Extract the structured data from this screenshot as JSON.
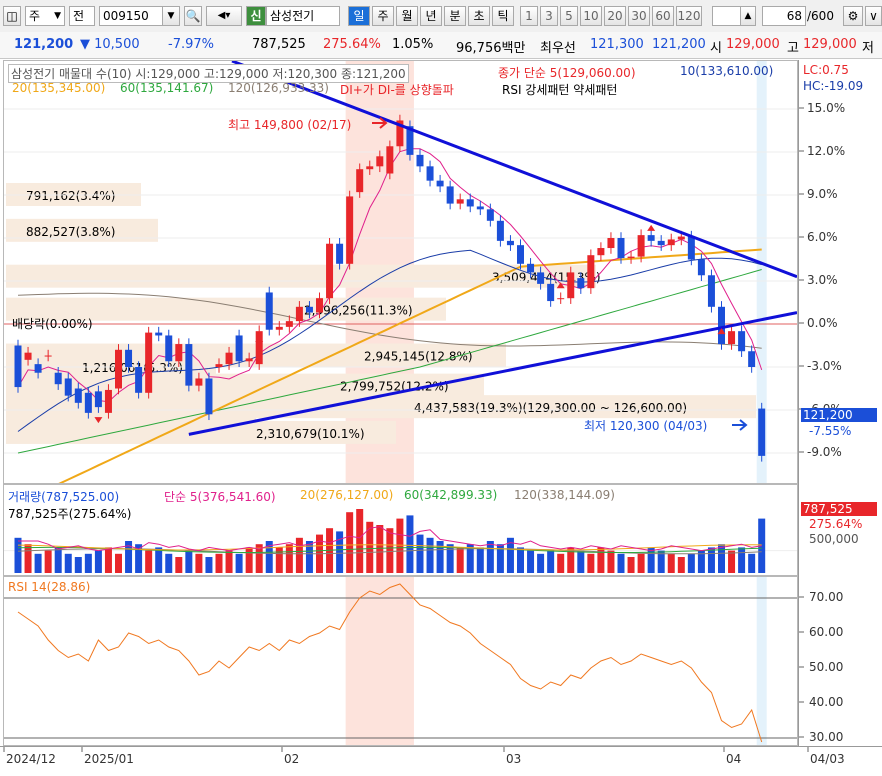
{
  "toolbar": {
    "type_select": "주",
    "mode_select": "전",
    "stock_code": "009150",
    "badge_new": "신",
    "stock_name": "삼성전기",
    "periods": [
      "일",
      "주",
      "월",
      "년",
      "분",
      "초",
      "틱"
    ],
    "active_period": "일",
    "numbers": [
      "1",
      "3",
      "5",
      "10",
      "20",
      "30",
      "60",
      "120"
    ],
    "page_count": "68",
    "page_total": "/600"
  },
  "info": {
    "price": "121,200",
    "change": "▼ 10,500",
    "change_rate": "-7.97%",
    "volume": "787,525",
    "volume_rate": "275.64%",
    "turnover": "1.05%",
    "amount": "96,756백만",
    "best_label": "최우선",
    "ask": "121,300",
    "bid": "121,200",
    "open_label": "시",
    "open": "129,000",
    "high_label": "고",
    "high": "129,000",
    "low_label": "저"
  },
  "price_panel": {
    "header": "삼성전기 매물대 수(10)  시:129,000 고:129,000 저:120,300 종:121,200",
    "ma5_label": "종가 단순 5(129,060.00)",
    "ma10_label": "10(133,610.00)",
    "ma20_label": "20(135,345.00)",
    "ma60_label": "60(135,141.67)",
    "ma120_label": "120(126,933.33)",
    "di_label": "DI+가 DI-를 상향돌파",
    "rsi_pattern_label": "RSI 강세패턴  약세패턴",
    "lc": "LC:0.75",
    "hc": "HC:-19.09",
    "dividend_label": "배당락(0.00%)",
    "high_annot": "최고 149,800 (02/17)",
    "low_annot": "최저 120,300 (04/03)",
    "current_price_tag": "121,200",
    "current_pct_tag": "-7.55%",
    "volume_profile": [
      {
        "label": "791,162(3.4%)"
      },
      {
        "label": "882,527(3.8%)"
      },
      {
        "label": "3,509,424(15.3%)"
      },
      {
        "label": "2,596,256(11.3%)"
      },
      {
        "label": "2,945,145(12.8%)"
      },
      {
        "label": "1,216,061(5.3%)"
      },
      {
        "label": "2,799,752(12.2%)"
      },
      {
        "label": "4,437,583(19.3%)(129,300.00 ~ 126,600.00)"
      },
      {
        "label": "1,491,380(6.5%)"
      },
      {
        "label": "2,310,679(10.1%)"
      }
    ],
    "y_ticks": [
      "15.0%",
      "12.0%",
      "9.0%",
      "6.0%",
      "3.0%",
      "0.0%",
      "-3.0%",
      "-6.0%",
      "-9.0%"
    ]
  },
  "volume_panel": {
    "header": "거래량(787,525.00)",
    "ma5": "단순 5(376,541.60)",
    "ma20": "20(276,127.00)",
    "ma60": "60(342,899.33)",
    "ma120": "120(338,144.09)",
    "sub": "787,525주(275.64%)",
    "tag_volume": "787,525",
    "tag_pct": "275.64%",
    "y_tick": "500,000"
  },
  "rsi_panel": {
    "header": "RSI 14(28.86)",
    "y_ticks": [
      "70.00",
      "60.00",
      "50.00",
      "40.00",
      "30.00"
    ]
  },
  "x_axis": [
    "2024/12",
    "2025/01",
    "02",
    "03",
    "04",
    "04/03"
  ],
  "colors": {
    "up": "#e8262a",
    "down": "#1b4fd8",
    "ma5": "#e0208c",
    "ma10": "#1a3da8",
    "ma20": "#f0a818",
    "ma60": "#2ea83e",
    "ma120": "#8a7e72",
    "trend": "#1010d8",
    "rsi": "#f07820"
  },
  "chart_data": [
    {
      "type": "candlestick",
      "title": "삼성전기",
      "y_unit": "% change",
      "ylim": [
        -9,
        15
      ],
      "x_range": [
        "2024/12",
        "2025/04/03"
      ],
      "x": [
        "2024/12",
        "",
        "",
        "",
        "",
        "",
        "",
        "2025/01",
        "",
        "",
        "",
        "",
        "",
        "",
        "",
        "",
        "",
        "",
        "",
        "",
        "",
        "",
        "",
        "",
        "",
        "",
        "02",
        "",
        "",
        "",
        "",
        "",
        "",
        "",
        "",
        "",
        "",
        "",
        "",
        "",
        "",
        "",
        "",
        "",
        "",
        "",
        "03",
        "",
        "",
        "",
        "",
        "",
        "",
        "",
        "",
        "",
        "",
        "",
        "",
        "",
        "",
        "",
        "",
        "",
        "",
        "",
        "",
        "",
        "04",
        "",
        "",
        "04/03"
      ],
      "series": [
        {
          "name": "price",
          "open": [
            -1.5,
            -2.5,
            -2.8,
            -2.2,
            -3.4,
            -3.8,
            -4.5,
            -4.8,
            -4.7,
            -6.2,
            -4.5,
            -1.8,
            -3.0,
            -4.8,
            -0.6,
            -0.8,
            -2.6,
            -1.4,
            -4.3,
            -3.8,
            -3.0,
            -2.8,
            -0.8,
            -2.6,
            -2.8,
            2.2,
            -0.4,
            -0.2,
            0.2,
            1.2,
            0.8,
            1.8,
            5.6,
            4.2,
            9.2,
            10.8,
            11.0,
            10.5,
            12.4,
            13.8,
            11.8,
            11.0,
            10.0,
            9.6,
            8.4,
            8.7,
            8.2,
            8.0,
            7.2,
            5.8,
            5.5,
            4.2,
            3.6,
            2.8,
            1.8,
            1.8,
            3.2,
            2.5,
            4.8,
            5.3,
            6.0,
            4.6,
            4.7,
            6.2,
            5.8,
            5.5,
            5.9,
            6.1,
            4.5,
            3.4,
            1.2,
            -1.4,
            -0.5,
            -1.9,
            -5.9
          ],
          "close": [
            -4.4,
            -2.0,
            -3.4,
            -2.2,
            -4.2,
            -5.0,
            -5.5,
            -6.2,
            -5.8,
            -4.6,
            -1.8,
            -3.0,
            -4.8,
            -0.6,
            -0.8,
            -2.6,
            -1.4,
            -4.3,
            -3.8,
            -6.3,
            -2.8,
            -2.0,
            -2.6,
            -2.4,
            -0.5,
            -0.4,
            -0.2,
            0.2,
            1.2,
            0.8,
            1.8,
            5.6,
            4.2,
            8.9,
            10.8,
            11.0,
            11.7,
            12.4,
            14.2,
            11.8,
            11.0,
            10.0,
            9.6,
            8.4,
            8.7,
            8.2,
            8.0,
            7.2,
            5.8,
            5.5,
            4.2,
            3.6,
            2.8,
            1.6,
            1.8,
            3.6,
            2.5,
            4.8,
            5.3,
            6.0,
            4.6,
            4.7,
            6.2,
            5.8,
            5.5,
            5.9,
            6.1,
            4.5,
            3.4,
            1.2,
            -1.4,
            -0.5,
            -1.9,
            -3.0,
            -9.2
          ]
        }
      ]
    },
    {
      "type": "bar",
      "title": "거래량",
      "values": [
        0.55,
        0.45,
        0.3,
        0.35,
        0.4,
        0.3,
        0.25,
        0.3,
        0.35,
        0.4,
        0.3,
        0.5,
        0.45,
        0.35,
        0.4,
        0.3,
        0.25,
        0.35,
        0.3,
        0.25,
        0.3,
        0.35,
        0.3,
        0.4,
        0.45,
        0.5,
        0.4,
        0.45,
        0.55,
        0.5,
        0.6,
        0.7,
        0.65,
        0.95,
        1.0,
        0.8,
        0.75,
        0.7,
        0.85,
        0.9,
        0.6,
        0.55,
        0.5,
        0.45,
        0.4,
        0.45,
        0.4,
        0.5,
        0.45,
        0.55,
        0.4,
        0.35,
        0.3,
        0.35,
        0.3,
        0.4,
        0.35,
        0.3,
        0.4,
        0.35,
        0.3,
        0.25,
        0.3,
        0.4,
        0.35,
        0.3,
        0.25,
        0.3,
        0.35,
        0.4,
        0.45,
        0.35,
        0.4,
        0.3,
        0.85
      ]
    },
    {
      "type": "line",
      "title": "RSI 14(28.86)",
      "ylim": [
        28,
        76
      ],
      "values": [
        66,
        64,
        62,
        58,
        55,
        53,
        54,
        52,
        58,
        55,
        56,
        60,
        59,
        57,
        58,
        56,
        55,
        52,
        48,
        49,
        52,
        50,
        53,
        56,
        55,
        57,
        55,
        58,
        57,
        59,
        60,
        62,
        61,
        66,
        70,
        72,
        71,
        73,
        74,
        71,
        68,
        67,
        65,
        63,
        62,
        60,
        57,
        55,
        53,
        51,
        47,
        45,
        44,
        46,
        45,
        48,
        47,
        50,
        52,
        53,
        51,
        52,
        54,
        53,
        52,
        51,
        52,
        50,
        46,
        43,
        35,
        33,
        34,
        38,
        28.86
      ]
    }
  ]
}
